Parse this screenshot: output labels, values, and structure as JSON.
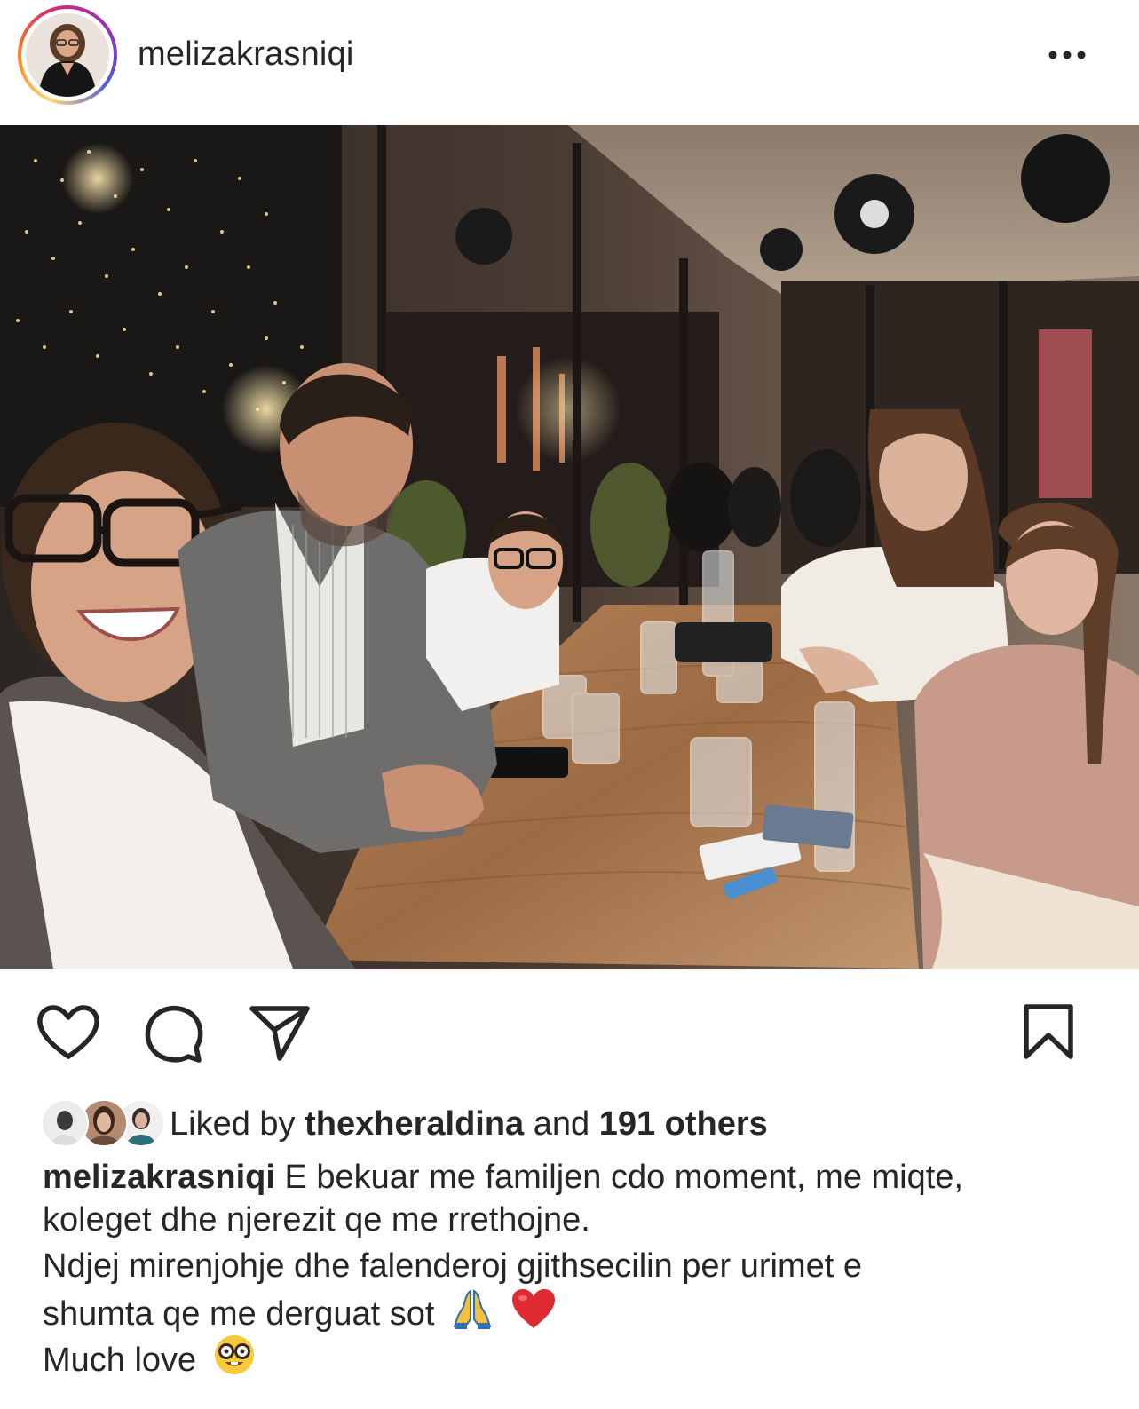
{
  "post": {
    "username": "melizakrasniqi",
    "more_icon": "more-horizontal-icon",
    "photo_alt": "Family dinner selfie at a restaurant table"
  },
  "actions": {
    "like_icon": "heart-icon",
    "comment_icon": "comment-icon",
    "share_icon": "send-icon",
    "save_icon": "bookmark-icon"
  },
  "likes": {
    "prefix": "Liked by",
    "user": "thexheraldina",
    "joiner": "and",
    "others": "191 others"
  },
  "caption": {
    "author": "melizakrasniqi",
    "line1": "E bekuar me familjen cdo moment, me miqte,",
    "line2": "koleget dhe njerezit qe me rrethojne.",
    "line3": "Ndjej mirenjohje dhe falenderoj gjithsecilin per urimet e",
    "line4": "shumta qe me derguat sot",
    "line5": "Much love",
    "emojis": [
      "folded-hands",
      "red-heart",
      "nerd-face"
    ]
  },
  "colors": {
    "text": "#262626",
    "ring_start": "#feda75",
    "ring_end": "#962fbf",
    "heart": "#e0245e"
  }
}
